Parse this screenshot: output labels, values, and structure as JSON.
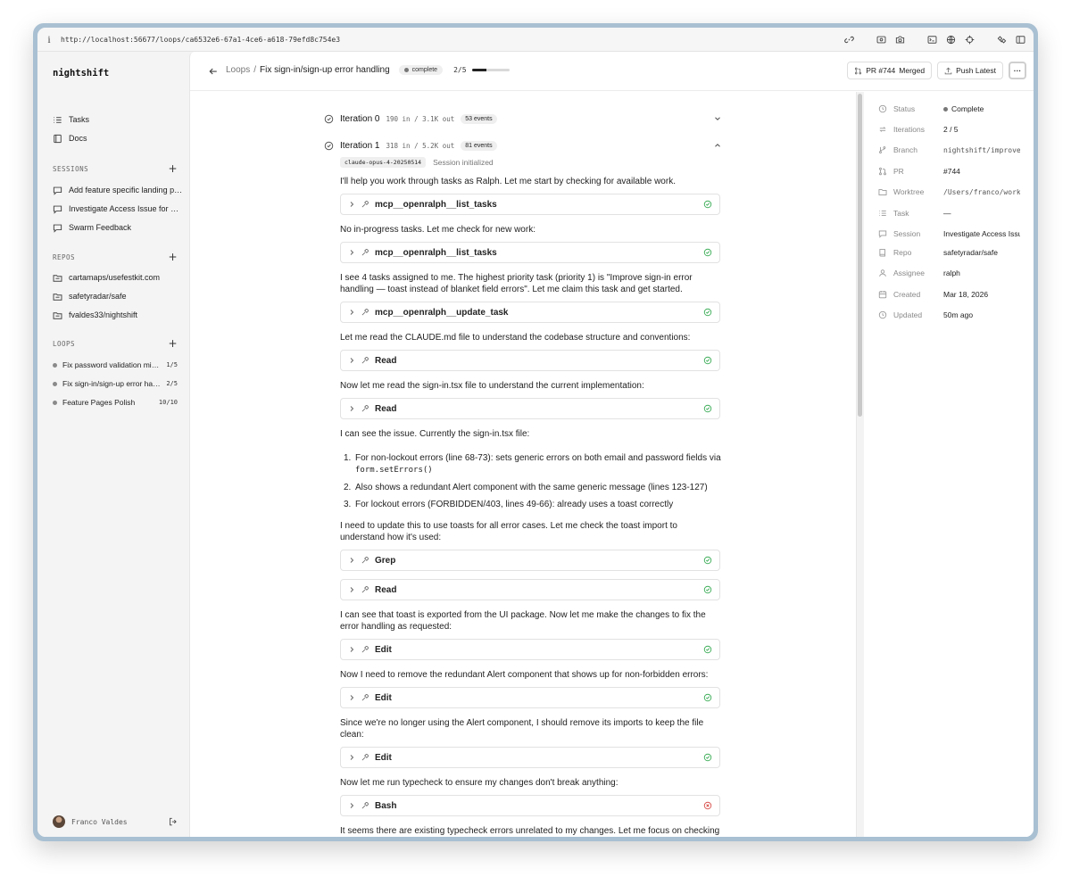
{
  "browser": {
    "url": "http://localhost:56677/loops/ca6532e6-67a1-4ce6-a618-79efd8c754e3"
  },
  "sidebar": {
    "brand": "nightshift",
    "nav": [
      {
        "label": "Tasks"
      },
      {
        "label": "Docs"
      }
    ],
    "sessions_title": "SESSIONS",
    "sessions": [
      {
        "label": "Add feature specific landing pages"
      },
      {
        "label": "Investigate Access Issue for Email"
      },
      {
        "label": "Swarm Feedback"
      }
    ],
    "repos_title": "REPOS",
    "repos": [
      {
        "label": "cartamaps/usefestkit.com"
      },
      {
        "label": "safetyradar/safe"
      },
      {
        "label": "fvaldes33/nightshift"
      }
    ],
    "loops_title": "LOOPS",
    "loops": [
      {
        "label": "Fix password validation mismatch",
        "count": "1/5"
      },
      {
        "label": "Fix sign-in/sign-up error handling",
        "count": "2/5"
      },
      {
        "label": "Feature Pages Polish",
        "count": "10/10"
      }
    ],
    "user": "Franco Valdes"
  },
  "header": {
    "crumb_root": "Loops",
    "crumb_sep": "/",
    "title": "Fix sign-in/sign-up error handling",
    "status": "complete",
    "progress_label": "2/5",
    "progress": 0.4,
    "pr_label": "PR #744",
    "pr_state": "Merged",
    "push_label": "Push Latest",
    "more_label": "···"
  },
  "iterations": [
    {
      "title": "Iteration 0",
      "tokens": "190 in / 3.1K out",
      "events": "53 events"
    },
    {
      "title": "Iteration 1",
      "tokens": "318 in / 5.2K out",
      "events": "81 events"
    }
  ],
  "model": {
    "tag": "claude-opus-4-20250514",
    "text": "Session initialized"
  },
  "transcript": {
    "p1": "I'll help you work through tasks as Ralph. Let me start by checking for available work.",
    "t1": "mcp__openralph__list_tasks",
    "p2": "No in-progress tasks. Let me check for new work:",
    "t2": "mcp__openralph__list_tasks",
    "p3": "I see 4 tasks assigned to me. The highest priority task (priority 1) is \"Improve sign-in error handling — toast instead of blanket field errors\". Let me claim this task and get started.",
    "t3": "mcp__openralph__update_task",
    "p4": "Let me read the CLAUDE.md file to understand the codebase structure and conventions:",
    "t4": "Read",
    "p5": "Now let me read the sign-in.tsx file to understand the current implementation:",
    "t5": "Read",
    "p6": "I can see the issue. Currently the sign-in.tsx file:",
    "list": {
      "i1_num": "1.",
      "i1_text": "For non-lockout errors (line 68-73): sets generic errors on both email and password fields via",
      "i1_code": "form.setErrors()",
      "i2_num": "2.",
      "i2_text": "Also shows a redundant Alert component with the same generic message (lines 123-127)",
      "i3_num": "3.",
      "i3_text": "For lockout errors (FORBIDDEN/403, lines 49-66): already uses a toast correctly"
    },
    "p7": "I need to update this to use toasts for all error cases. Let me check the toast import to understand how it's used:",
    "t6": "Grep",
    "t7": "Read",
    "p8": "I can see that toast is exported from the UI package. Now let me make the changes to fix the error handling as requested:",
    "t8": "Edit",
    "p9": "Now I need to remove the redundant Alert component that shows up for non-forbidden errors:",
    "t9": "Edit",
    "p10": "Since we're no longer using the Alert component, I should remove its imports to keep the file clean:",
    "t10": "Edit",
    "p11": "Now let me run typecheck to ensure my changes don't break anything:",
    "t11": "Bash",
    "p12": "It seems there are existing typecheck errors unrelated to my changes. Let me focus on checking"
  },
  "tool_status": {
    "success_color": "#3fae5a",
    "error_color": "#d9534f"
  },
  "details": {
    "status_label": "Status",
    "status_value": "Complete",
    "iterations_label": "Iterations",
    "iterations_value": "2 / 5",
    "branch_label": "Branch",
    "branch_value": "nightshift/improve-sign-in-error-handling",
    "pr_label": "PR",
    "pr_value": "#744",
    "worktree_label": "Worktree",
    "worktree_value": "/Users/franco/worktrees",
    "task_label": "Task",
    "task_value": "—",
    "session_label": "Session",
    "session_value": "Investigate Access Issue for Email",
    "repo_label": "Repo",
    "repo_value": "safetyradar/safe",
    "assignee_label": "Assignee",
    "assignee_value": "ralph",
    "created_label": "Created",
    "created_value": "Mar 18, 2026",
    "updated_label": "Updated",
    "updated_value": "50m ago"
  }
}
